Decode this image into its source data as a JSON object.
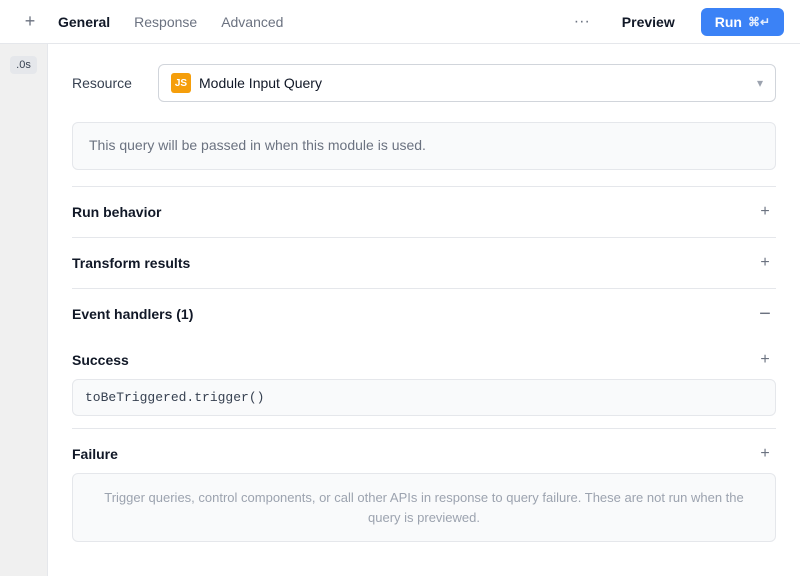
{
  "topbar": {
    "add_icon": "+",
    "tabs": [
      {
        "id": "general",
        "label": "General",
        "active": true
      },
      {
        "id": "response",
        "label": "Response",
        "active": false
      },
      {
        "id": "advanced",
        "label": "Advanced",
        "active": false
      }
    ],
    "more_icon": "···",
    "preview_label": "Preview",
    "run_label": "Run",
    "run_shortcut": "⌘↵"
  },
  "sidebar": {
    "chip_label": ".0s"
  },
  "resource": {
    "label": "Resource",
    "js_badge": "JS",
    "name": "Module Input Query",
    "chevron": "▾"
  },
  "info_box": {
    "text": "This query will be passed in when this module is used."
  },
  "sections": [
    {
      "id": "run-behavior",
      "label": "Run behavior",
      "icon": "+"
    },
    {
      "id": "transform-results",
      "label": "Transform results",
      "icon": "+"
    }
  ],
  "event_handlers": {
    "title": "Event handlers (1)",
    "collapse_icon": "−",
    "success": {
      "title": "Success",
      "plus_icon": "+",
      "code": "toBeTriggered.trigger()"
    },
    "failure": {
      "title": "Failure",
      "plus_icon": "+",
      "placeholder": "Trigger queries, control components, or call other APIs in response to query failure. These are not run when the query is previewed."
    }
  }
}
